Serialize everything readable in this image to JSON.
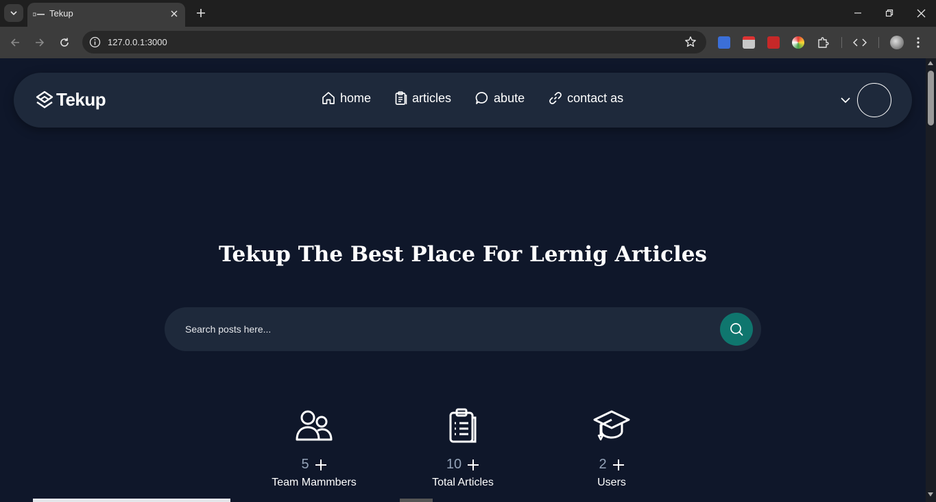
{
  "browser": {
    "tab_title": "Tekup",
    "url": "127.0.0.1:3000"
  },
  "navbar": {
    "logo_text": "Tekup",
    "links": [
      {
        "label": "home",
        "icon": "home-icon"
      },
      {
        "label": "articles",
        "icon": "clipboard-icon"
      },
      {
        "label": "abute",
        "icon": "chat-bubble-icon"
      },
      {
        "label": "contact as",
        "icon": "link-icon"
      }
    ]
  },
  "hero": {
    "title": "Tekup The Best Place For Lernig Articles"
  },
  "search": {
    "placeholder": "Search posts here..."
  },
  "stats": [
    {
      "count": "5",
      "label": "Team Mammbers",
      "icon": "users-icon"
    },
    {
      "count": "10",
      "label": "Total Articles",
      "icon": "clipboard-list-icon"
    },
    {
      "count": "2",
      "label": "Users",
      "icon": "graduation-cap-icon"
    }
  ],
  "colors": {
    "page_bg": "#0f172a",
    "navbar_bg": "#1e293b",
    "accent": "#0f766e",
    "muted_text": "#94a3b8"
  }
}
